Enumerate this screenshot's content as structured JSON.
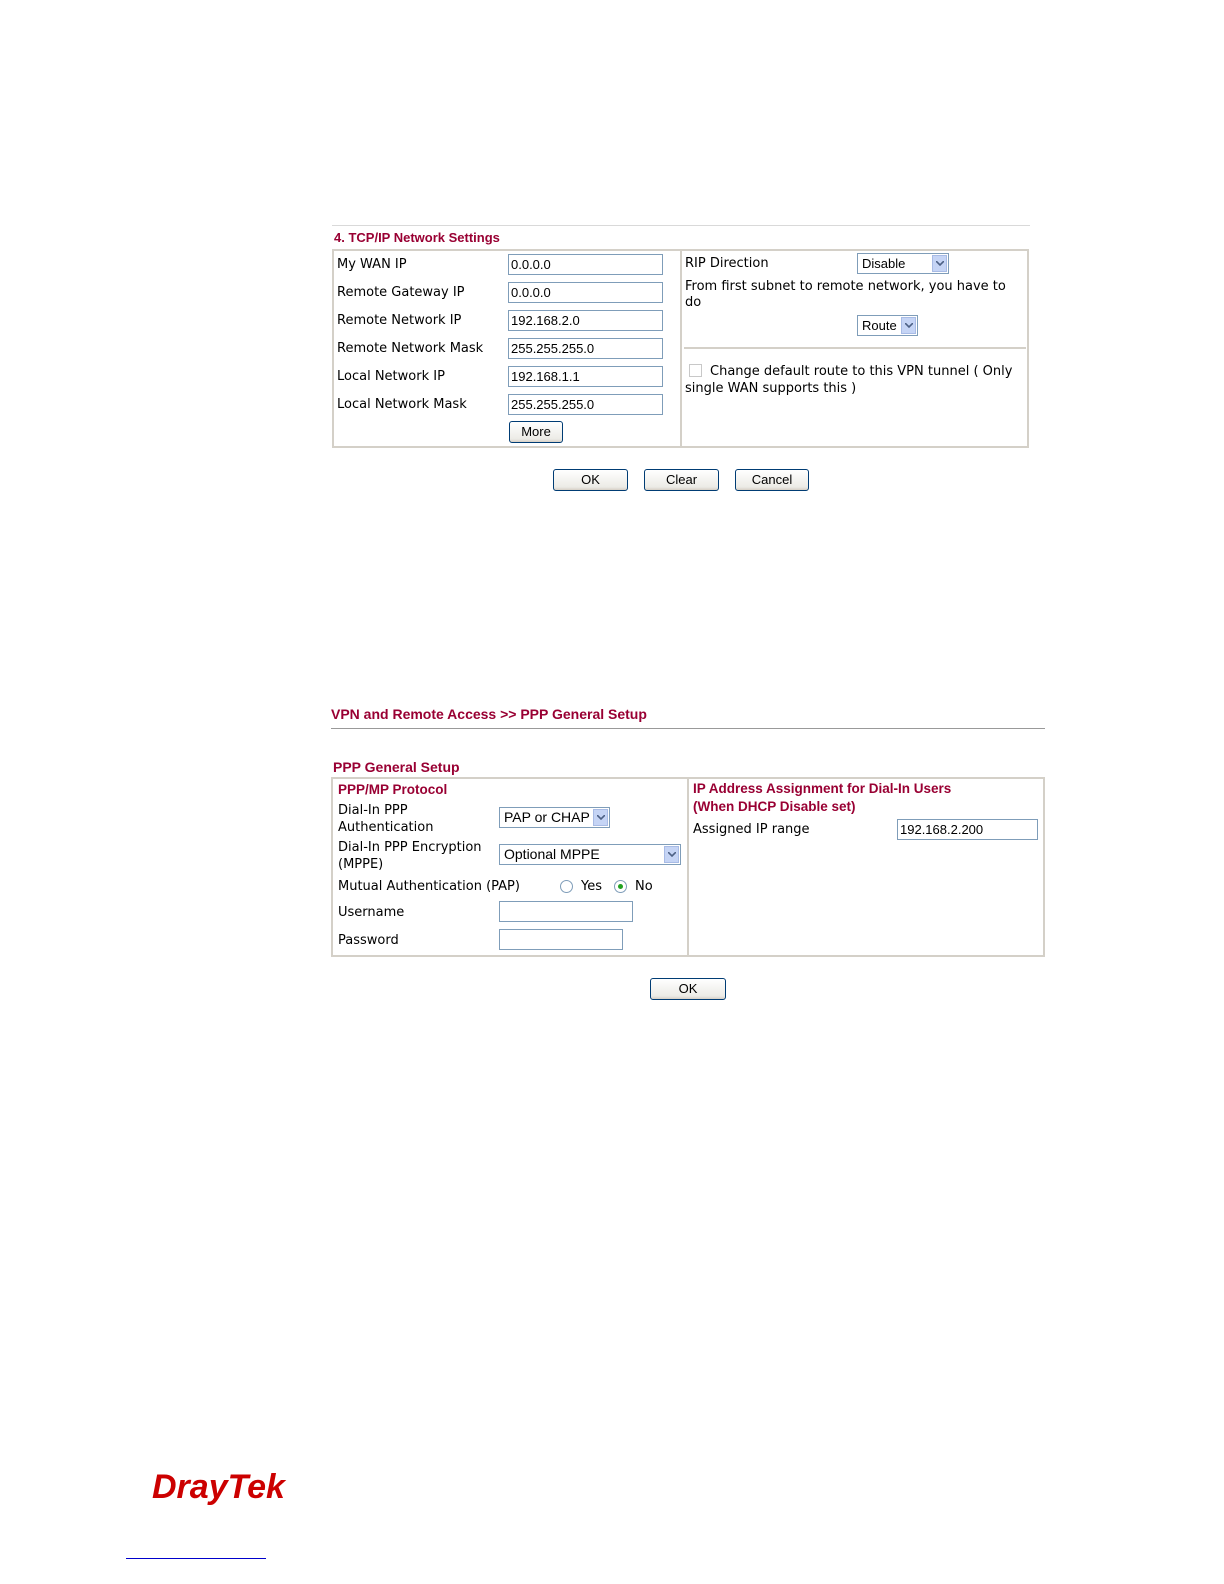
{
  "tcpip": {
    "title": "4. TCP/IP Network Settings",
    "fields": [
      {
        "label": "My WAN IP",
        "value": "0.0.0.0"
      },
      {
        "label": "Remote Gateway IP",
        "value": "0.0.0.0"
      },
      {
        "label": "Remote Network IP",
        "value": "192.168.2.0"
      },
      {
        "label": "Remote Network Mask",
        "value": "255.255.255.0"
      },
      {
        "label": "Local Network IP",
        "value": "192.168.1.1"
      },
      {
        "label": "Local Network Mask",
        "value": "255.255.255.0"
      }
    ],
    "more_label": "More",
    "rip_label": "RIP Direction",
    "rip_value": "Disable",
    "subnet_text": "From first subnet to remote network, you have to do",
    "route_value": "Route",
    "default_route_text": "Change default route to this VPN tunnel ( Only single WAN supports this )",
    "buttons": {
      "ok": "OK",
      "clear": "Clear",
      "cancel": "Cancel"
    }
  },
  "ppp": {
    "breadcrumb": "VPN and Remote Access >> PPP General Setup",
    "section_title": "PPP General Setup",
    "protocol_title": "PPP/MP Protocol",
    "dialin_auth_label": "Dial-In PPP Authentication",
    "dialin_auth_value": "PAP or CHAP",
    "encryption_label": "Dial-In PPP Encryption (MPPE)",
    "encryption_value": "Optional MPPE",
    "mutual_label": "Mutual Authentication (PAP)",
    "yes_label": "Yes",
    "no_label": "No",
    "mutual_selected": "No",
    "username_label": "Username",
    "username_value": "",
    "password_label": "Password",
    "password_value": "",
    "ip_assign_title": "IP Address Assignment for Dial-In Users",
    "ip_assign_subtitle": "(When DHCP Disable set)",
    "assigned_label": "Assigned IP range",
    "assigned_value": "192.168.2.200",
    "ok_label": "OK"
  },
  "footer": {
    "brand": "DrayTek",
    "brand_color": "#cc0000"
  }
}
